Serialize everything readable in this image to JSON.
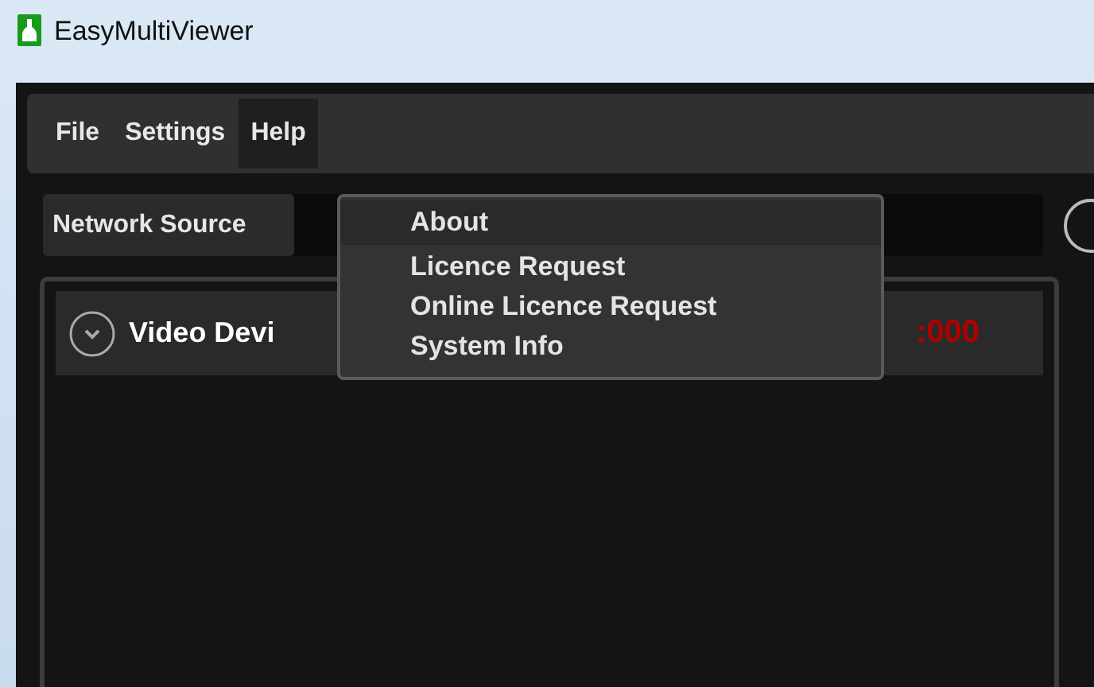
{
  "window": {
    "title": "EasyMultiViewer"
  },
  "menu_bar": [
    {
      "label": "File",
      "selected": false
    },
    {
      "label": "Settings",
      "selected": false
    },
    {
      "label": "Help",
      "selected": true
    }
  ],
  "help_menu": {
    "items": [
      {
        "label": "About",
        "selected": true
      },
      {
        "label": "Licence Request",
        "selected": false
      },
      {
        "label": "Online Licence Request",
        "selected": false
      },
      {
        "label": "System Info",
        "selected": false
      }
    ]
  },
  "source_bar": {
    "label": "Network Source"
  },
  "device_row": {
    "label": "Video Devi",
    "timecode": ":000"
  }
}
